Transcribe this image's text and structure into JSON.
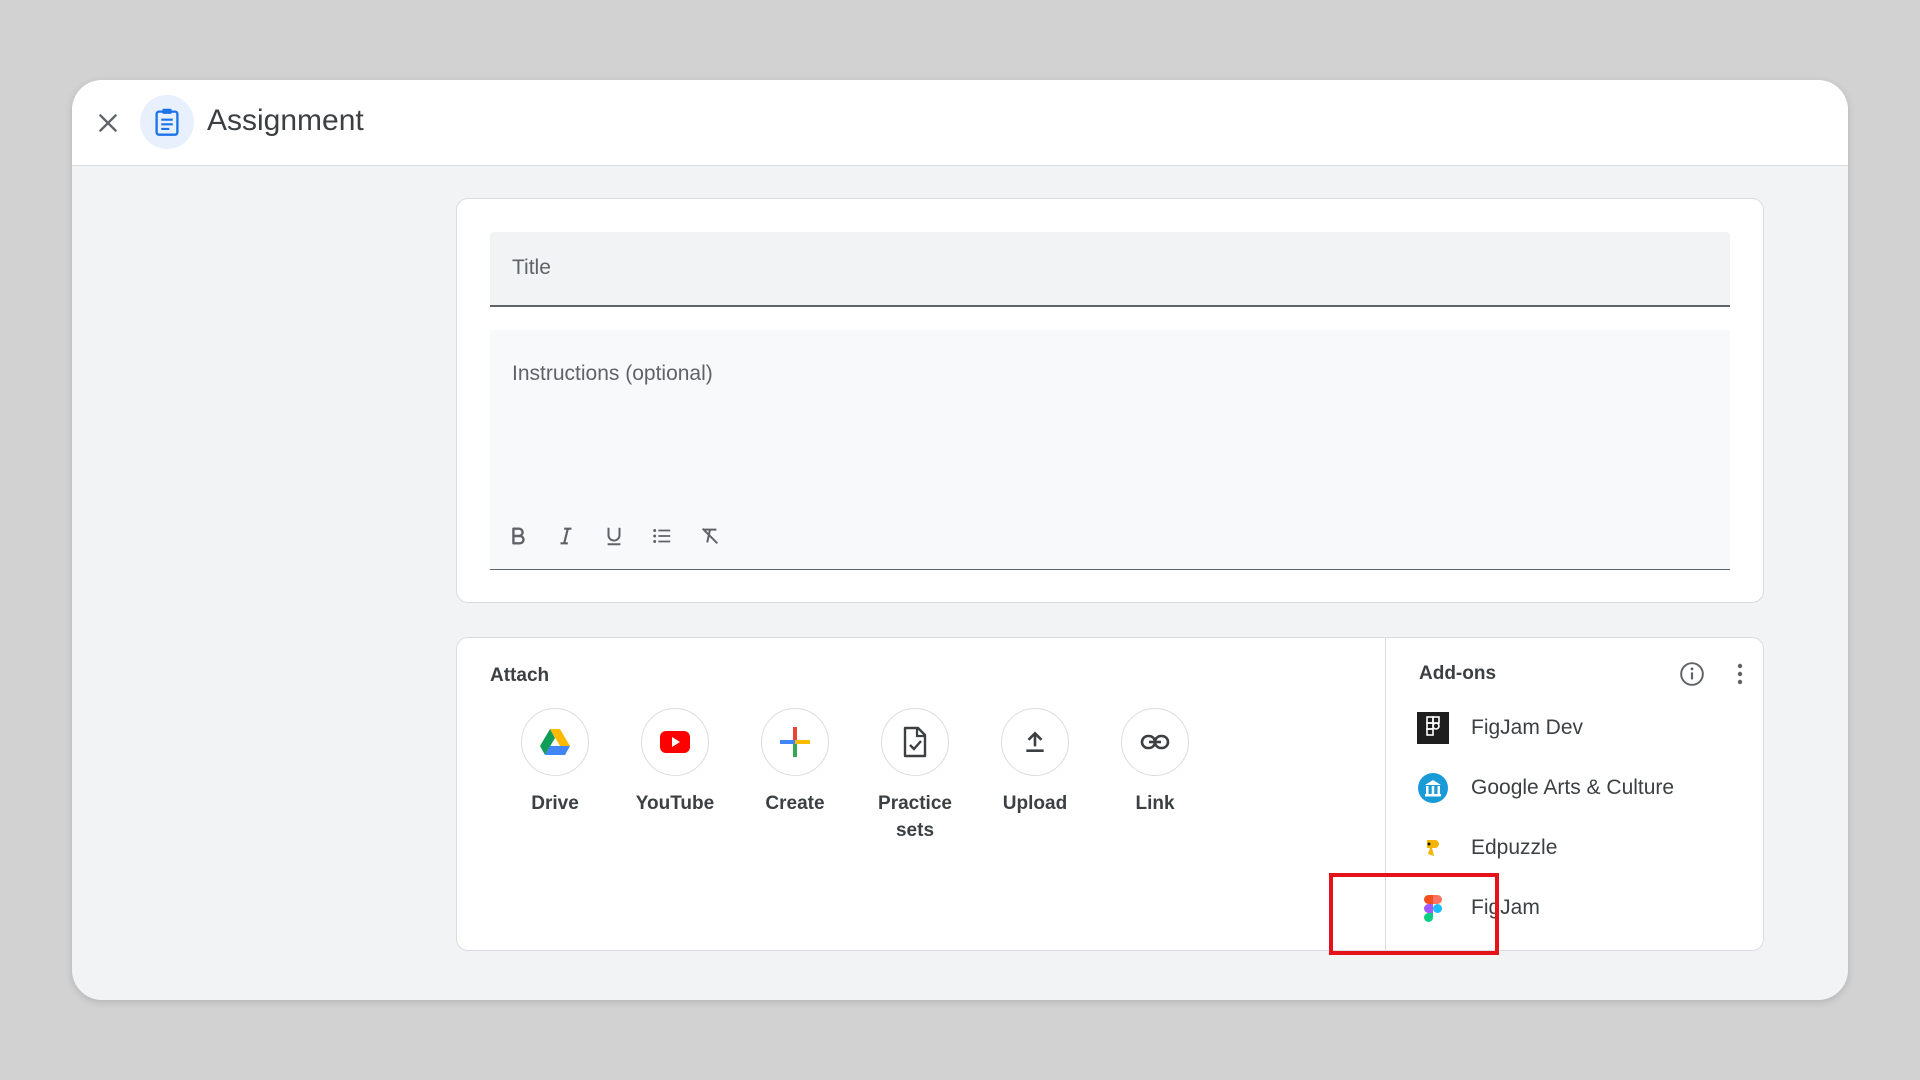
{
  "header": {
    "close_icon": "close-icon",
    "app_icon": "assignment-icon",
    "title": "Assignment"
  },
  "form": {
    "title_placeholder": "Title",
    "instructions_placeholder": "Instructions (optional)",
    "formatting": [
      "bold-icon",
      "italic-icon",
      "underline-icon",
      "bulleted-list-icon",
      "clear-formatting-icon"
    ]
  },
  "attach": {
    "label": "Attach",
    "items": [
      {
        "label": "Drive",
        "icon": "google-drive-icon"
      },
      {
        "label": "YouTube",
        "icon": "youtube-icon"
      },
      {
        "label": "Create",
        "icon": "plus-icon"
      },
      {
        "label": "Practice sets",
        "icon": "practice-sets-icon"
      },
      {
        "label": "Upload",
        "icon": "upload-icon"
      },
      {
        "label": "Link",
        "icon": "link-icon"
      }
    ]
  },
  "addons": {
    "label": "Add-ons",
    "info_icon": "info-icon",
    "more_icon": "more-vert-icon",
    "items": [
      {
        "label": "FigJam Dev",
        "icon": "figjam-dev-icon"
      },
      {
        "label": "Google Arts & Culture",
        "icon": "google-arts-culture-icon"
      },
      {
        "label": "Edpuzzle",
        "icon": "edpuzzle-icon"
      },
      {
        "label": "FigJam",
        "icon": "figma-icon"
      }
    ]
  },
  "colors": {
    "highlight": "#e5121a",
    "accent": "#1a73e8",
    "background": "#d2d2d2"
  }
}
